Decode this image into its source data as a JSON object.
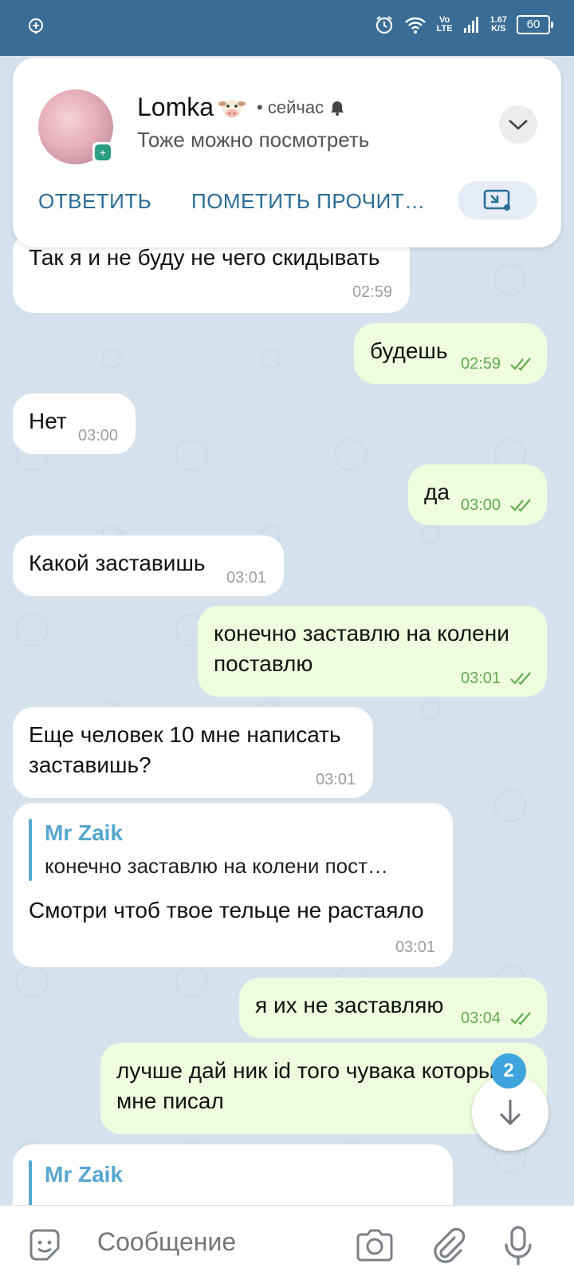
{
  "status_bar": {
    "network_type": "Vo LTE",
    "speed_value": "1.67",
    "speed_unit": "K/S",
    "battery": "60"
  },
  "notification": {
    "sender": "Lomka",
    "time": "• сейчас",
    "text": "Тоже можно посмотреть",
    "reply_label": "ОТВЕТИТЬ",
    "mark_read_label": "ПОМЕТИТЬ ПРОЧИТ…"
  },
  "messages": [
    {
      "text": "Так я и не буду не чего скидывать",
      "time": "02:59"
    },
    {
      "text": "будешь",
      "time": "02:59"
    },
    {
      "text": "Нет",
      "time": "03:00"
    },
    {
      "text": "да",
      "time": "03:00"
    },
    {
      "text": "Какой заставишь",
      "time": "03:01"
    },
    {
      "text": "конечно заставлю на колени\nпоставлю",
      "time": "03:01"
    },
    {
      "text": "Еще человек 10 мне написать\nзаставишь?",
      "time": "03:01"
    },
    {
      "reply_name": "Mr Zaik",
      "reply_text": "конечно заставлю на колени пост…",
      "text": "Смотри чтоб твое тельце не растаяло",
      "time": "03:01"
    },
    {
      "text": "я их не заставляю",
      "time": "03:04"
    },
    {
      "text": "лучше дай ник id того чувака который\nмне писал",
      "time": ""
    },
    {
      "reply_name": "Mr Zaik"
    }
  ],
  "scroll_down_badge": "2",
  "input": {
    "placeholder": "Сообщение"
  },
  "colors": {
    "status_bar": "#3a6d96",
    "incoming": "#ffffff",
    "outgoing": "#effdde",
    "accent": "#56a7d0"
  }
}
